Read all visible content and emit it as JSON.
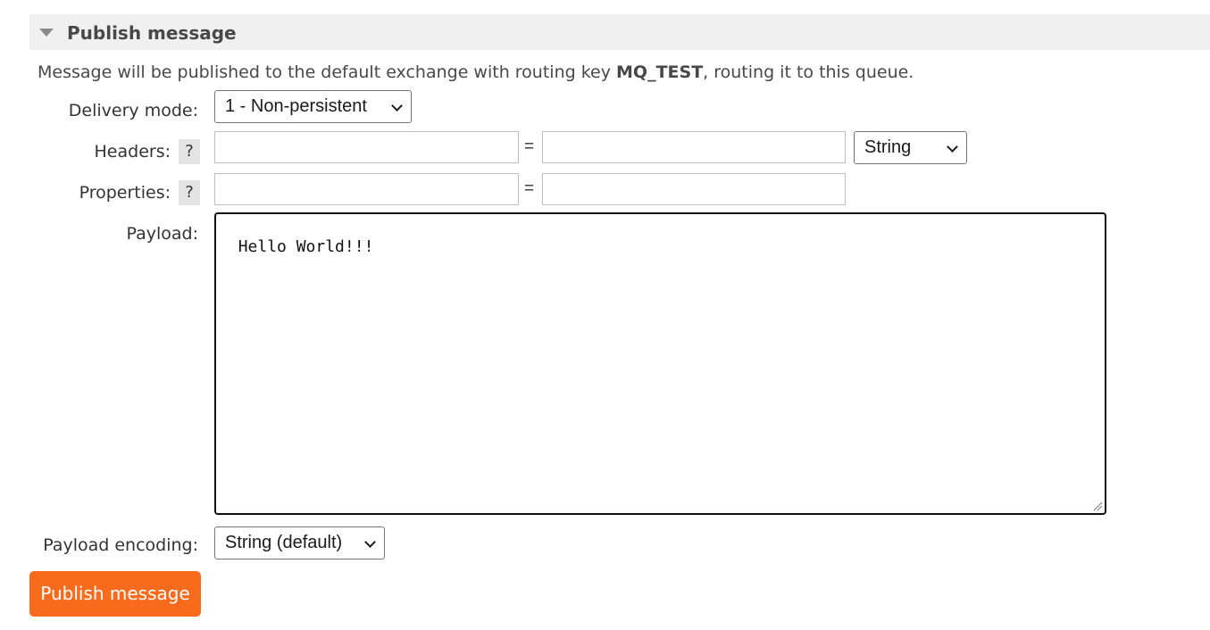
{
  "section": {
    "title": "Publish message",
    "collapse_icon": "triangle-down-icon"
  },
  "info": {
    "prefix": "Message will be published to the default exchange with routing key ",
    "routing_key": "MQ_TEST",
    "suffix": ", routing it to this queue."
  },
  "form": {
    "delivery_mode": {
      "label": "Delivery mode:",
      "value": "1 - Non-persistent"
    },
    "headers": {
      "label": "Headers:",
      "help": "?",
      "key_value": "",
      "equals": "=",
      "value_value": "",
      "type": "String"
    },
    "properties": {
      "label": "Properties:",
      "help": "?",
      "key_value": "",
      "equals": "=",
      "value_value": ""
    },
    "payload": {
      "label": "Payload:",
      "value": "Hello World!!!"
    },
    "payload_encoding": {
      "label": "Payload encoding:",
      "value": "String (default)"
    }
  },
  "actions": {
    "publish_label": "Publish message"
  },
  "colors": {
    "publish_button": "#f96b1c",
    "header_bg": "#f0f0f0"
  }
}
